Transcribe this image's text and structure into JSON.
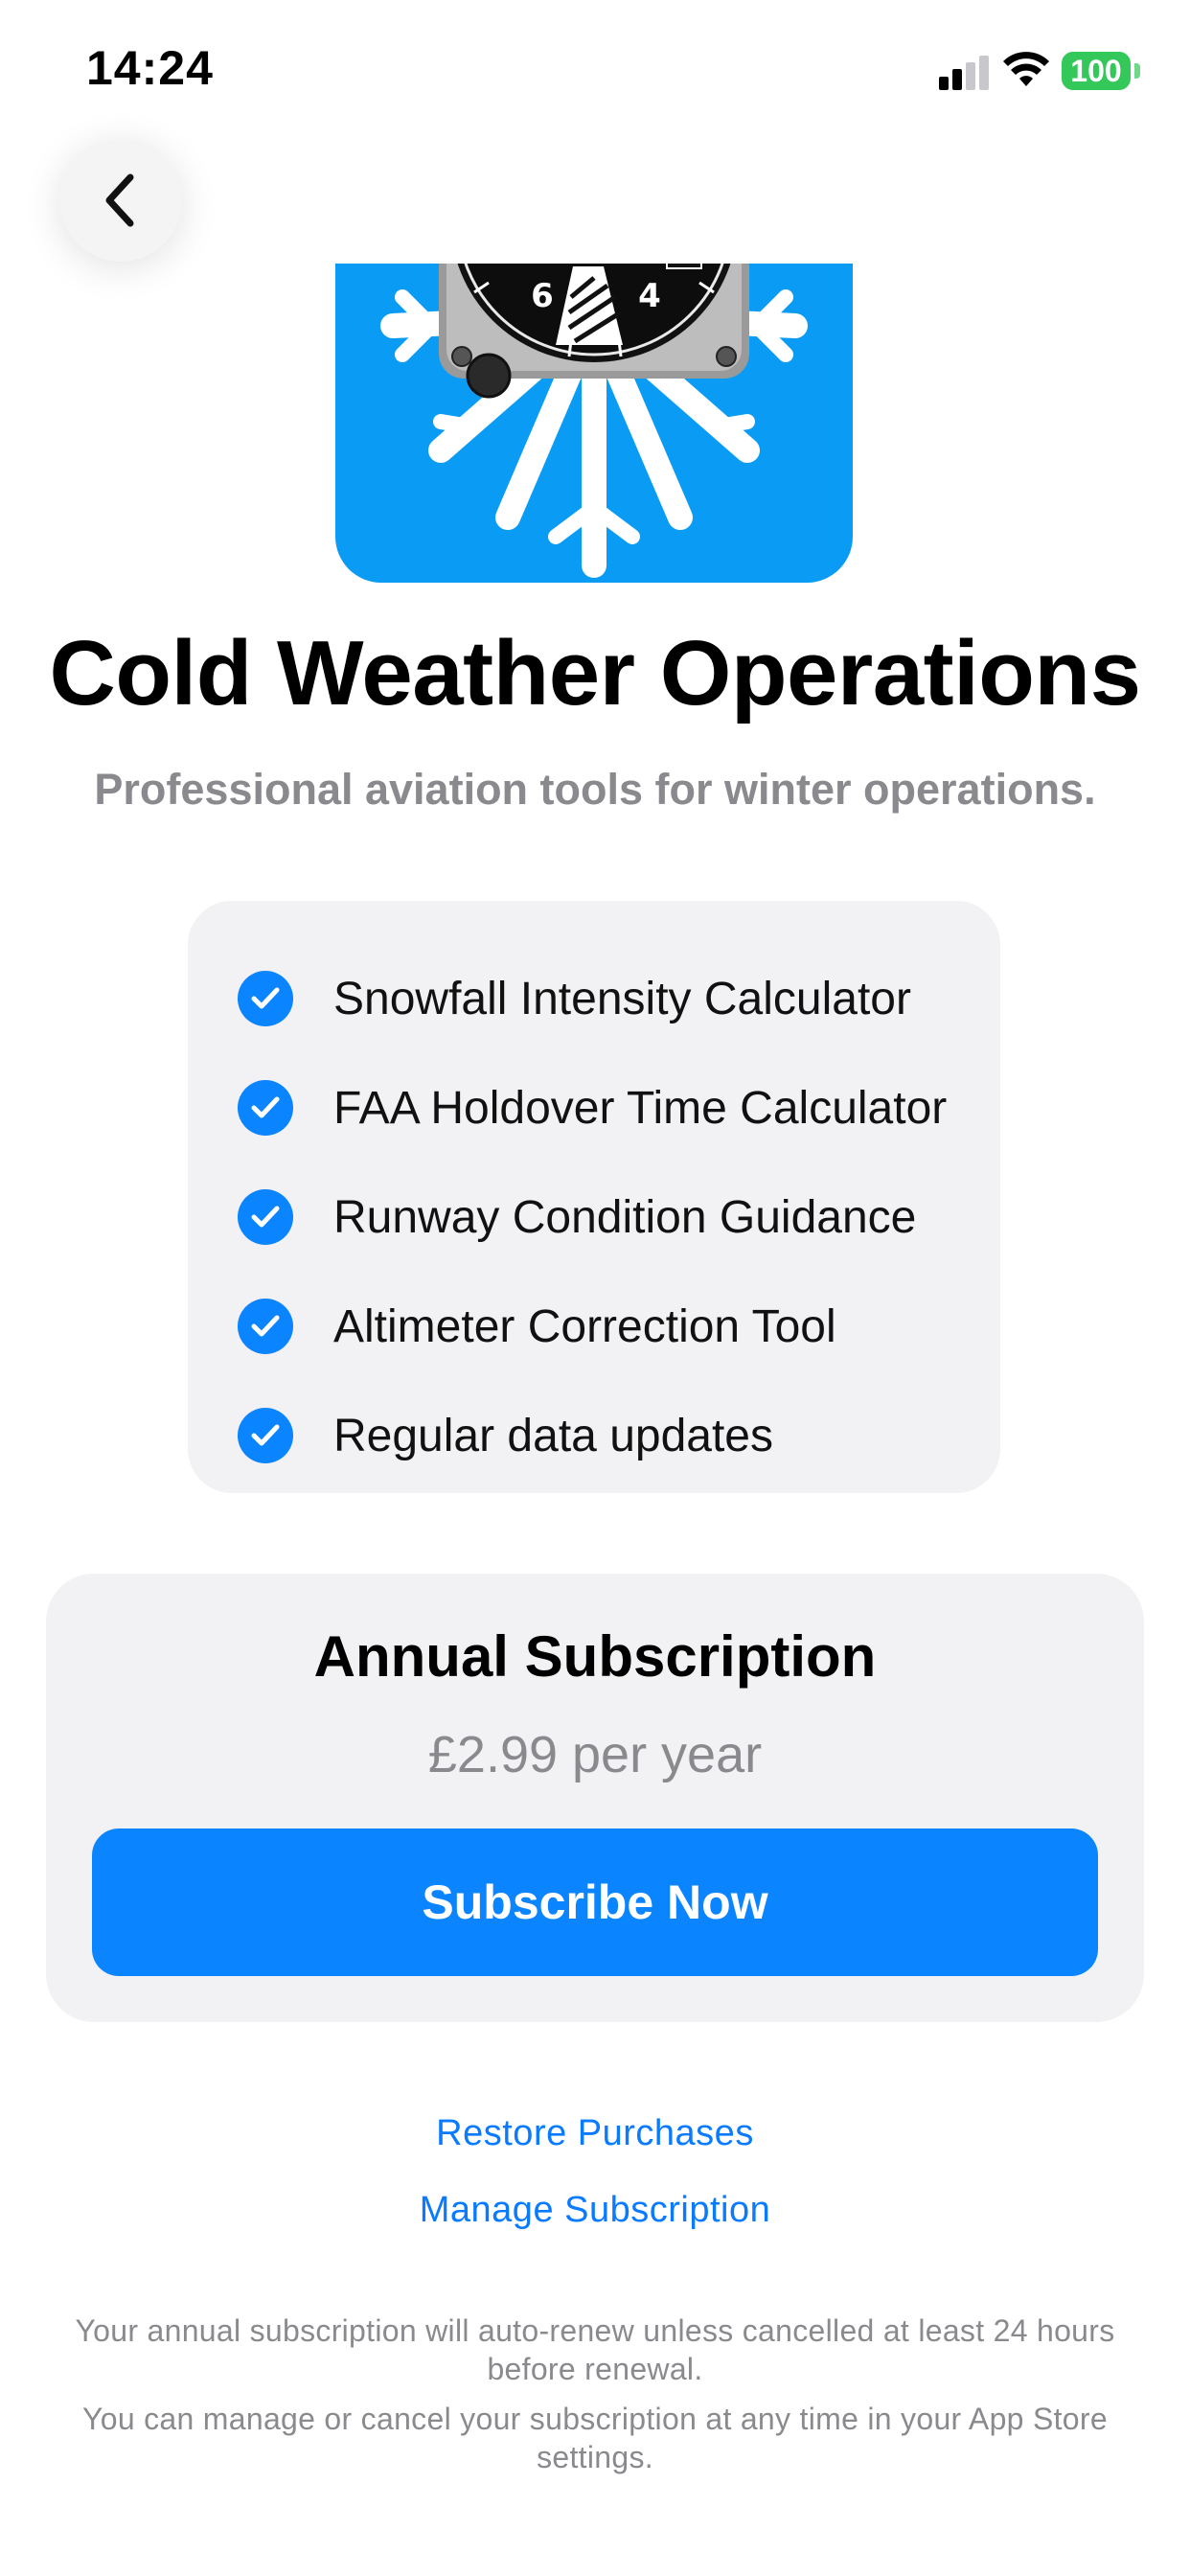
{
  "status_bar": {
    "time": "14:24",
    "battery": "100",
    "icons": [
      "cellular-signal-icon",
      "wifi-icon",
      "battery-icon"
    ]
  },
  "nav": {
    "back_icon": "chevron-left-icon"
  },
  "app": {
    "icon_name": "altimeter-snowflake-app-icon",
    "title": "Cold Weather Operations",
    "subtitle": "Professional aviation tools for winter operations."
  },
  "features": [
    {
      "label": "Snowfall Intensity Calculator"
    },
    {
      "label": "FAA Holdover Time Calculator"
    },
    {
      "label": "Runway Condition Guidance"
    },
    {
      "label": "Altimeter Correction Tool"
    },
    {
      "label": "Regular data updates"
    }
  ],
  "subscription": {
    "title": "Annual Subscription",
    "price": "£2.99 per year",
    "button_label": "Subscribe Now"
  },
  "links": {
    "restore": "Restore Purchases",
    "manage": "Manage Subscription"
  },
  "legal": {
    "line1": "Your annual subscription will auto-renew unless cancelled at least 24 hours before renewal.",
    "line2": "You can manage or cancel your subscription at any time in your App Store settings."
  },
  "colors": {
    "accent": "#0a84ff",
    "icon_background": "#0a9cf5",
    "card_background": "#f2f2f4",
    "secondary_text": "#8a8a8e",
    "battery": "#34c759"
  }
}
